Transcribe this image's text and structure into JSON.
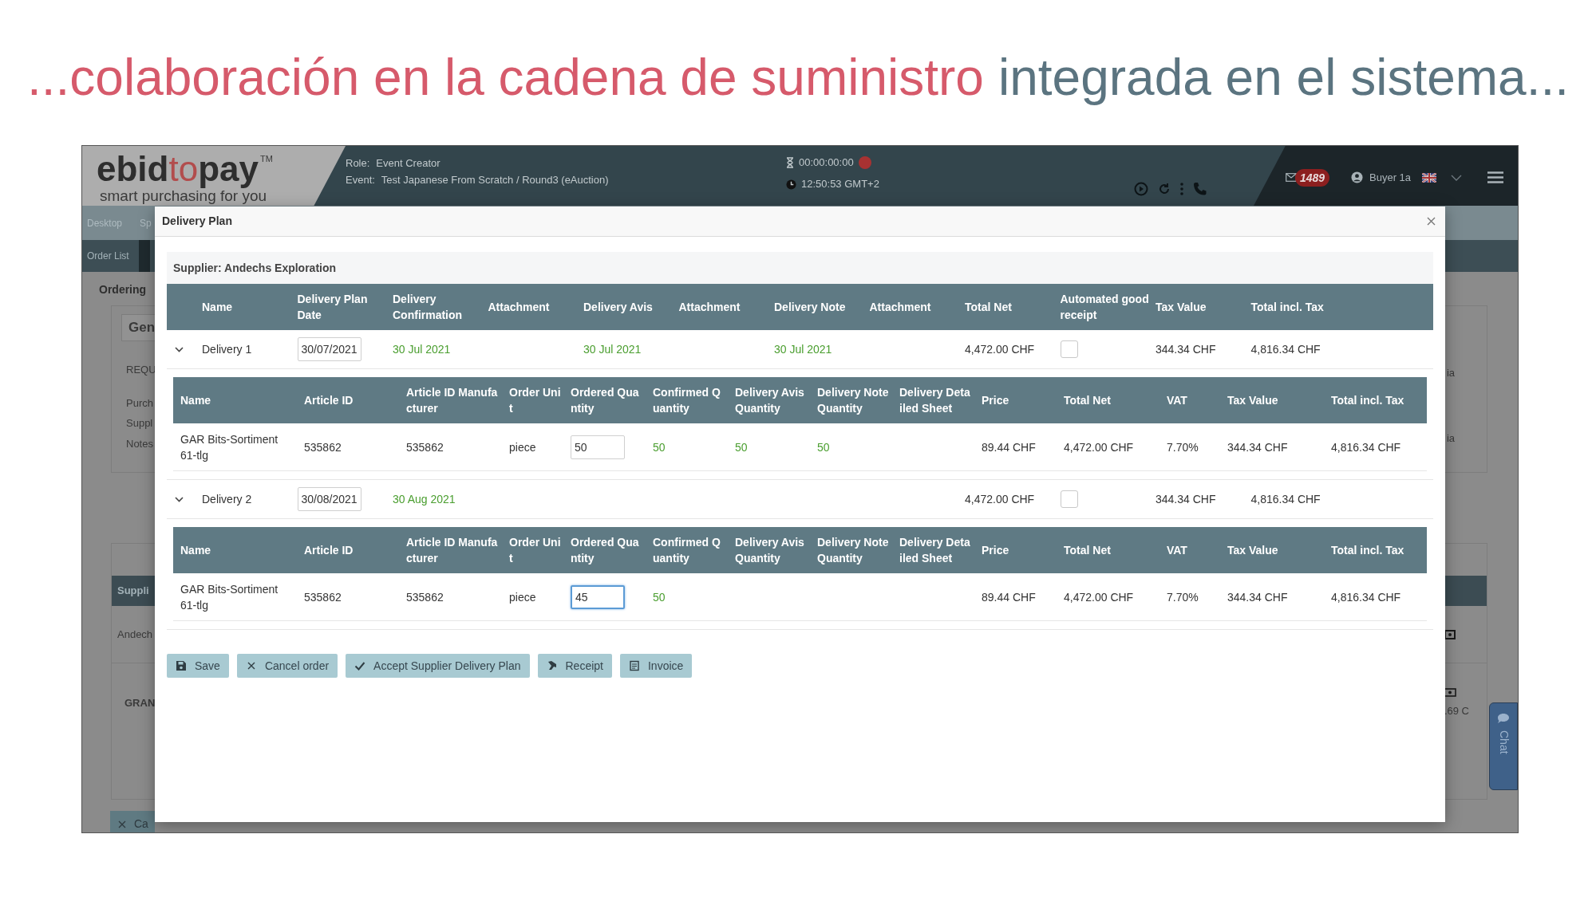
{
  "slide_title": {
    "highlight": "...colaboración en la cadena de suministro",
    "rest": "integrada en el sistema..."
  },
  "app": {
    "logo": {
      "start": "ebid",
      "middle": "to",
      "end": "pay",
      "trademark": "TM",
      "tagline": "smart purchasing for you"
    },
    "context": [
      {
        "label": "Role:",
        "value": "Event Creator"
      },
      {
        "label": "Event:",
        "value": "Test Japanese From Scratch / Round3 (eAuction)"
      }
    ],
    "timer": "00:00:00:00",
    "clock": "12:50:53 GMT+2",
    "notifications": "1489",
    "user": "Buyer 1a",
    "nav": [
      "Desktop",
      "Sp"
    ],
    "subnav": "Order List",
    "page_title": "Ordering",
    "panel_tab": "Gen",
    "panel_labels": [
      "REQU",
      "Purch",
      "Suppl",
      "Notes"
    ],
    "panel_right": [
      "ia",
      "ia"
    ],
    "supplier_header": "Suppli",
    "supplier_name": "Andech",
    "grand_label": "GRAN",
    "grand_value": ".69 C",
    "cancel_button": "Ca",
    "chat": "Chat"
  },
  "modal": {
    "title": "Delivery Plan",
    "supplier": "Supplier: Andechs Exploration",
    "columns": [
      "Name",
      "Delivery Plan Date",
      "Delivery Confirmation",
      "Attachment",
      "Delivery Avis",
      "Attachment",
      "Delivery Note",
      "Attachment",
      "Total Net",
      "Automated good receipt",
      "Tax Value",
      "Total incl. Tax"
    ],
    "deliveries": [
      {
        "name": "Delivery 1",
        "expanded": true,
        "plan_date": "30/07/2021",
        "confirmation": "30 Jul 2021",
        "avis": "30 Jul 2021",
        "note": "30 Jul 2021",
        "total_net": "4,472.00 CHF",
        "automated_receipt": false,
        "tax_value": "344.34 CHF",
        "total_incl_tax": "4,816.34 CHF",
        "item_columns": [
          "Name",
          "Article ID",
          "Article ID Manufacturer",
          "Order Unit",
          "Ordered Quantity",
          "Confirmed Quantity",
          "Delivery Avis Quantity",
          "Delivery Note Quantity",
          "Delivery Detailed Sheet",
          "Price",
          "Total Net",
          "VAT",
          "Tax Value",
          "Total incl. Tax"
        ],
        "items": [
          {
            "name": "GAR Bits-Sortiment 61-tlg",
            "article_id": "535862",
            "manufacturer_id": "535862",
            "unit": "piece",
            "ordered": "50",
            "focused": false,
            "confirmed": "50",
            "avis_quantity": "50",
            "note_quantity": "50",
            "price": "89.44 CHF",
            "total_net": "4,472.00 CHF",
            "vat": "7.70%",
            "tax_value": "344.34 CHF",
            "total_incl_tax": "4,816.34 CHF"
          }
        ]
      },
      {
        "name": "Delivery 2",
        "expanded": true,
        "plan_date": "30/08/2021",
        "confirmation": "30 Aug 2021",
        "total_net": "4,472.00 CHF",
        "automated_receipt": false,
        "tax_value": "344.34 CHF",
        "total_incl_tax": "4,816.34 CHF",
        "item_columns": [
          "Name",
          "Article ID",
          "Article ID Manufacturer",
          "Order Unit",
          "Ordered Quantity",
          "Confirmed Quantity",
          "Delivery Avis Quantity",
          "Delivery Note Quantity",
          "Delivery Detailed Sheet",
          "Price",
          "Total Net",
          "VAT",
          "Tax Value",
          "Total incl. Tax"
        ],
        "items": [
          {
            "name": "GAR Bits-Sortiment 61-tlg",
            "article_id": "535862",
            "manufacturer_id": "535862",
            "unit": "piece",
            "ordered": "45",
            "focused": true,
            "confirmed": "50",
            "price": "89.44 CHF",
            "total_net": "4,472.00 CHF",
            "vat": "7.70%",
            "tax_value": "344.34 CHF",
            "total_incl_tax": "4,816.34 CHF"
          }
        ]
      }
    ],
    "buttons": [
      {
        "label": "Save",
        "kind": "save"
      },
      {
        "label": "Cancel order",
        "kind": "cancel"
      },
      {
        "label": "Accept Supplier Delivery Plan",
        "kind": "accept"
      },
      {
        "label": "Receipt",
        "kind": "receipt"
      },
      {
        "label": "Invoice",
        "kind": "invoice"
      }
    ]
  }
}
